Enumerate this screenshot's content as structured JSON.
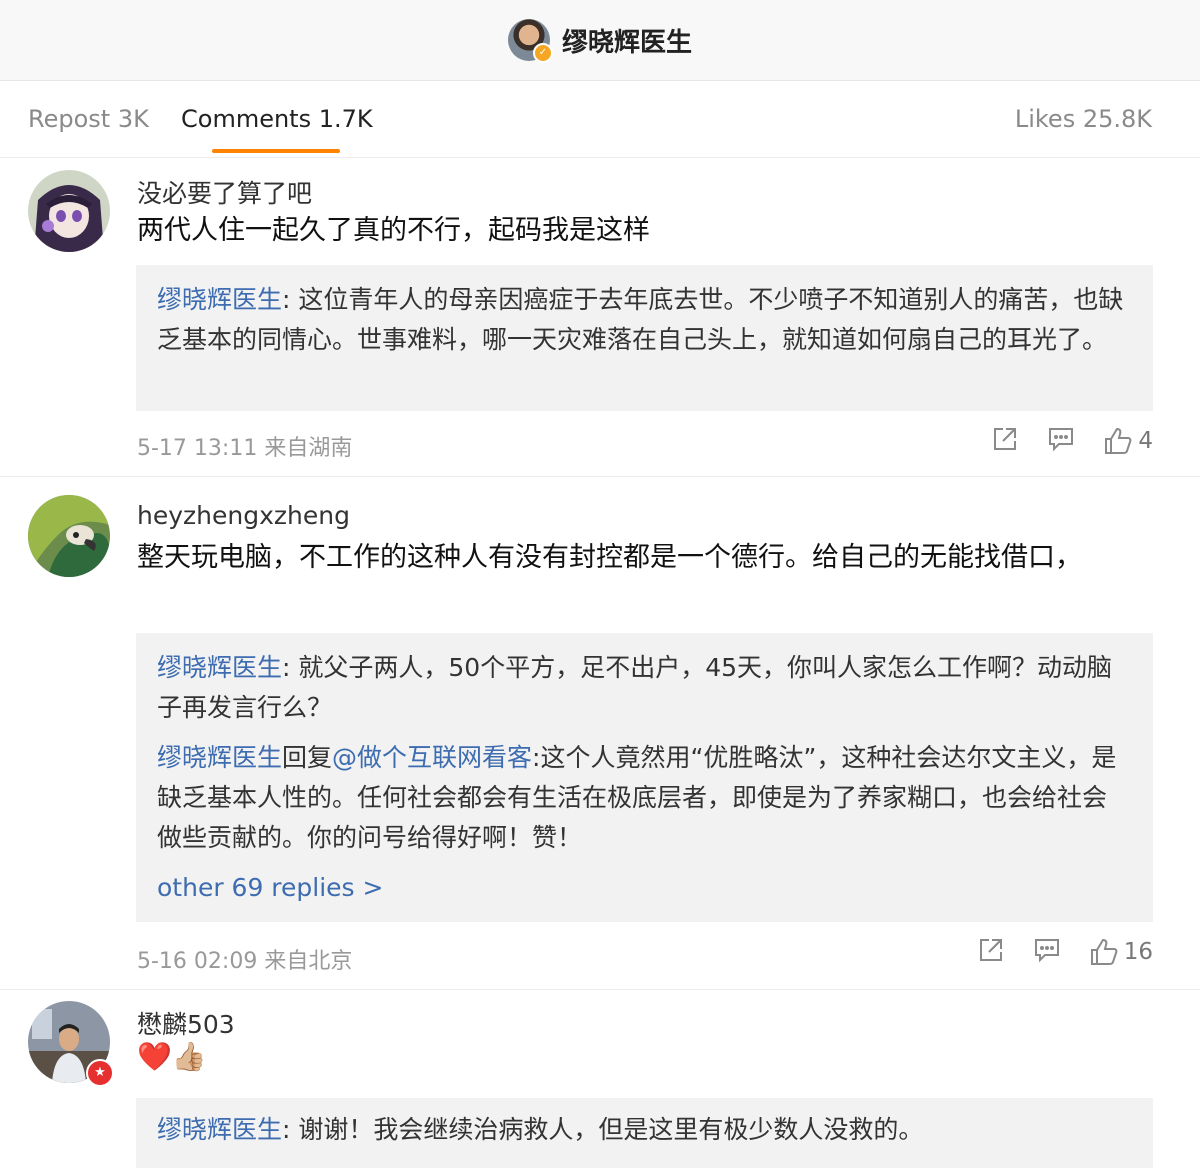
{
  "header": {
    "title": "缪晓辉医生",
    "avatar_icon": "user-avatar",
    "badge_icon": "verified-badge-icon"
  },
  "tabs": {
    "repost": "Repost 3K",
    "comments": "Comments 1.7K",
    "likes": "Likes 25.8K",
    "accent_color": "#ff8200"
  },
  "comments": [
    {
      "username": "没必要了算了吧",
      "text": "两代人住一起久了真的不行，起码我是这样",
      "replies": [
        {
          "name": "缪晓辉医生",
          "sep": ": ",
          "text": "这位青年人的母亲因癌症于去年底去世。不少喷子不知道别人的痛苦，也缺乏基本的同情心。世事难料，哪一天灾难落在自己头上，就知道如何扇自己的耳光了。"
        }
      ],
      "meta": "5-17 13:11 来自湖南",
      "likes": "4"
    },
    {
      "username": "heyzhengxzheng",
      "text": "整天玩电脑，不工作的这种人有没有封控都是一个德行。给自己的无能找借口，",
      "replies": [
        {
          "name": "缪晓辉医生",
          "sep": ": ",
          "text": "就父子两人，50个平方，足不出户，45天，你叫人家怎么工作啊？动动脑子再发言行么？"
        },
        {
          "name": "缪晓辉医生",
          "reply_word": "回复",
          "mention": "@做个互联网看客",
          "sep": ":",
          "text": "这个人竟然用“优胜略汰”，这种社会达尔文主义，是缺乏基本人性的。任何社会都会有生活在极底层者，即使是为了养家糊口，也会给社会做些贡献的。你的问号给得好啊！赞！"
        }
      ],
      "more_replies": "other 69 replies >",
      "meta": "5-16 02:09 来自北京",
      "likes": "16"
    },
    {
      "username": "懋麟503",
      "emoji": "❤️👍🏼",
      "replies": [
        {
          "name": "缪晓辉医生",
          "sep": ": ",
          "text": "谢谢！我会继续治病救人，但是这里有极少数人没救的。"
        }
      ]
    }
  ]
}
